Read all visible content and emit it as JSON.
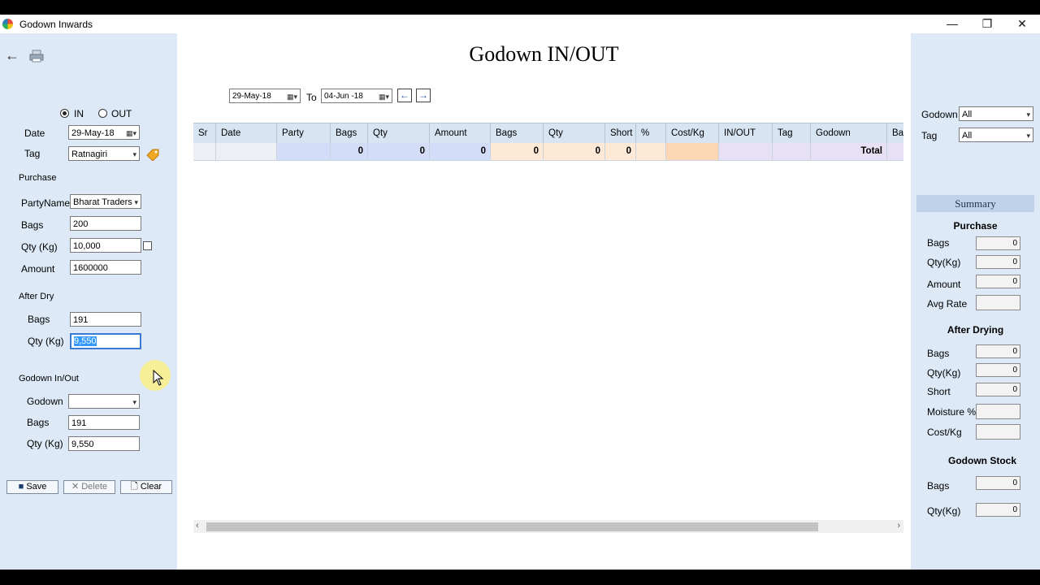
{
  "window": {
    "title": "Godown Inwards",
    "minimize": "—",
    "restore": "❐",
    "close": "✕"
  },
  "page_title": "Godown IN/OUT",
  "entry": {
    "radio_in": "IN",
    "radio_out": "OUT",
    "date_label": "Date",
    "date_value": "29-May-18",
    "tag_label": "Tag",
    "tag_value": "Ratnagiri",
    "purchase_section": "Purchase",
    "party_label": "PartyName",
    "party_value": "Bharat Traders",
    "bags_label": "Bags",
    "bags_value": "200",
    "qty_label": "Qty (Kg)",
    "qty_value": "10,000",
    "amount_label": "Amount",
    "amount_value": "1600000",
    "afterdry_section": "After Dry",
    "ad_bags_label": "Bags",
    "ad_bags_value": "191",
    "ad_qty_label": "Qty (Kg)",
    "ad_qty_value": "9,550",
    "godown_section": "Godown In/Out",
    "godown_label": "Godown",
    "godown_value": "",
    "g_bags_label": "Bags",
    "g_bags_value": "191",
    "g_qty_label": "Qty (Kg)",
    "g_qty_value": "9,550"
  },
  "actions": {
    "save": "Save",
    "delete": "Delete",
    "clear": "Clear"
  },
  "filter": {
    "from_date": "29-May-18",
    "to_label": "To",
    "to_date": "04-Jun -18"
  },
  "grid": {
    "headers": [
      "Sr",
      "Date",
      "Party",
      "Bags",
      "Qty",
      "Amount",
      "Bags",
      "Qty",
      "Short",
      "%",
      "Cost/Kg",
      "IN/OUT",
      "Tag",
      "Godown",
      "Bag"
    ],
    "totals": {
      "bags": "0",
      "qty": "0",
      "amount": "0",
      "ad_bags": "0",
      "ad_qty": "0",
      "short": "0",
      "label": "Total"
    }
  },
  "right": {
    "godown_label": "Godown",
    "godown_value": "All",
    "tag_label": "Tag",
    "tag_value": "All",
    "summary_title": "Summary",
    "purchase_title": "Purchase",
    "p_bags_label": "Bags",
    "p_bags_value": "0",
    "p_qty_label": "Qty(Kg)",
    "p_qty_value": "0",
    "p_amount_label": "Amount",
    "p_amount_value": "0",
    "p_avgrate_label": "Avg Rate",
    "p_avgrate_value": "",
    "afterdry_title": "After Drying",
    "a_bags_label": "Bags",
    "a_bags_value": "0",
    "a_qty_label": "Qty(Kg)",
    "a_qty_value": "0",
    "a_short_label": "Short",
    "a_short_value": "0",
    "a_moist_label": "Moisture %",
    "a_moist_value": "",
    "a_cost_label": "Cost/Kg",
    "a_cost_value": "",
    "stock_title": "Godown Stock",
    "s_bags_label": "Bags",
    "s_bags_value": "0",
    "s_qty_label": "Qty(Kg)",
    "s_qty_value": "0"
  }
}
